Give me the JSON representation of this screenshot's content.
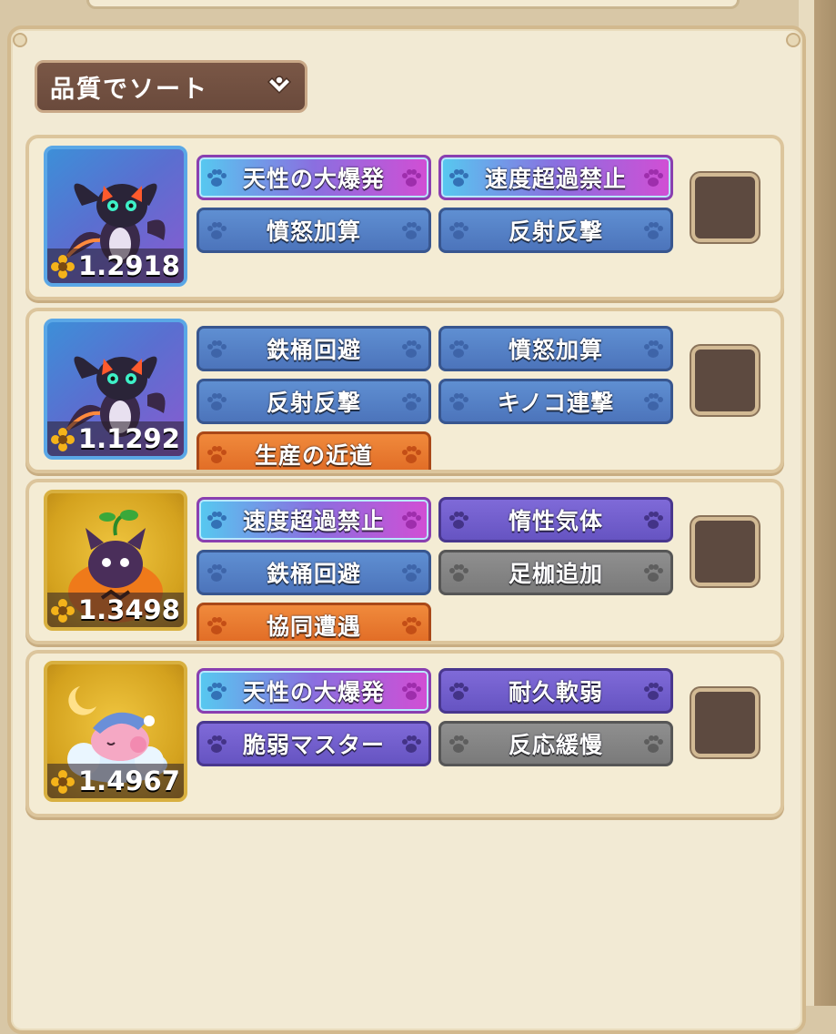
{
  "sort": {
    "label": "品質でソート"
  },
  "colors": {
    "panel": "#f2ead4",
    "sort_button": "#6a4a3c",
    "checkbox": "#5d4a40"
  },
  "entries": [
    {
      "score": "1.2918",
      "creature": "dragon-creature",
      "frame": "blue",
      "selected": false,
      "tags": [
        {
          "label": "天性の大爆発",
          "style": "cyan-pink"
        },
        {
          "label": "速度超過禁止",
          "style": "cyan-pink"
        },
        {
          "label": "憤怒加算",
          "style": "blue"
        },
        {
          "label": "反射反撃",
          "style": "blue"
        }
      ]
    },
    {
      "score": "1.1292",
      "creature": "dragon-creature",
      "frame": "blue",
      "selected": false,
      "tags": [
        {
          "label": "鉄桶回避",
          "style": "blue"
        },
        {
          "label": "憤怒加算",
          "style": "blue"
        },
        {
          "label": "反射反撃",
          "style": "blue"
        },
        {
          "label": "キノコ連撃",
          "style": "blue"
        },
        {
          "label": "生産の近道",
          "style": "orange"
        }
      ]
    },
    {
      "score": "1.3498",
      "creature": "pumpkin-cat-creature",
      "frame": "gold",
      "selected": false,
      "tags": [
        {
          "label": "速度超過禁止",
          "style": "cyan-pink"
        },
        {
          "label": "惰性気体",
          "style": "purple"
        },
        {
          "label": "鉄桶回避",
          "style": "blue"
        },
        {
          "label": "足枷追加",
          "style": "gray"
        },
        {
          "label": "協同遭遇",
          "style": "orange"
        }
      ]
    },
    {
      "score": "1.4967",
      "creature": "sleepy-pig-creature",
      "frame": "gold",
      "selected": false,
      "tags": [
        {
          "label": "天性の大爆発",
          "style": "cyan-pink"
        },
        {
          "label": "耐久軟弱",
          "style": "purple"
        },
        {
          "label": "脆弱マスター",
          "style": "purple"
        },
        {
          "label": "反応緩慢",
          "style": "gray"
        }
      ]
    }
  ]
}
